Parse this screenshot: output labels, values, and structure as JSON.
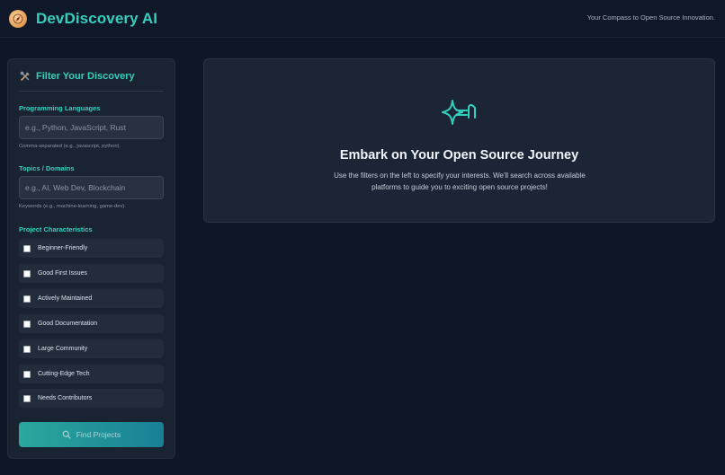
{
  "header": {
    "brand": "DevDiscovery AI",
    "tagline": "Your Compass to Open Source Innovation.",
    "logo_icon": "compass-icon"
  },
  "sidebar": {
    "title": "Filter Your Discovery",
    "title_icon": "tools-icon",
    "languages": {
      "label": "Programming Languages",
      "placeholder": "e.g., Python, JavaScript, Rust",
      "value": "",
      "hint": "Comma-separated (e.g., javascript, python)."
    },
    "topics": {
      "label": "Topics / Domains",
      "placeholder": "e.g., AI, Web Dev, Blockchain",
      "value": "",
      "hint": "Keywords (e.g., machine-learning, game-dev)."
    },
    "characteristics": {
      "label": "Project Characteristics",
      "items": [
        {
          "label": "Beginner-Friendly",
          "checked": false
        },
        {
          "label": "Good First Issues",
          "checked": false
        },
        {
          "label": "Actively Maintained",
          "checked": false
        },
        {
          "label": "Good Documentation",
          "checked": false
        },
        {
          "label": "Large Community",
          "checked": false
        },
        {
          "label": "Cutting-Edge Tech",
          "checked": false
        },
        {
          "label": "Needs Contributors",
          "checked": false
        }
      ]
    },
    "find_button": {
      "label": "Find Projects",
      "icon": "search-icon"
    }
  },
  "main": {
    "icon": "sparkle-icon",
    "title": "Embark on Your Open Source Journey",
    "description": "Use the filters on the left to specify your interests. We'll search across available platforms to guide you to exciting open source projects!"
  },
  "colors": {
    "accent": "#35d0bd",
    "background": "#0f1626",
    "panel": "#1a2332",
    "button_start": "#2aa89d",
    "button_end": "#1a7f95"
  }
}
